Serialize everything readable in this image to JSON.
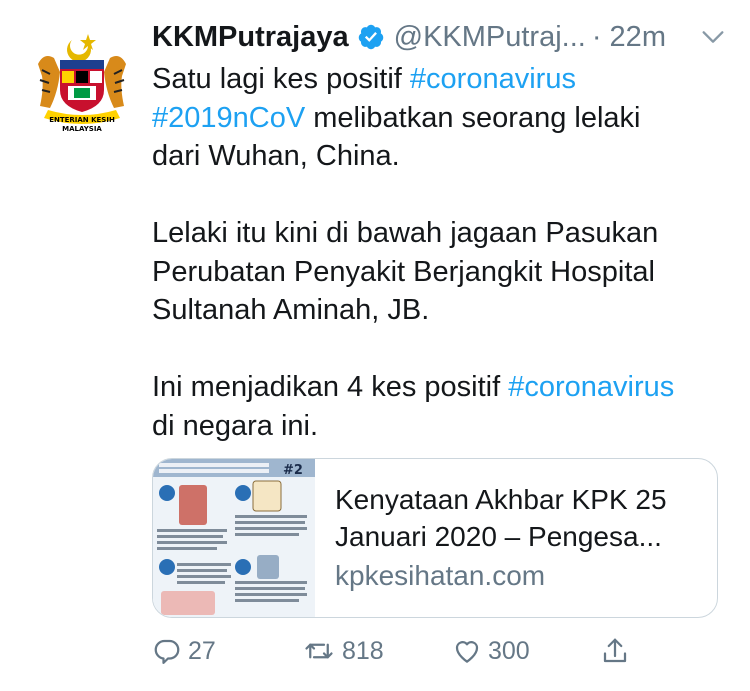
{
  "tweet": {
    "display_name": "KKMPutrajaya",
    "handle": "@KKMPutraj...",
    "time": "· 22m",
    "lines": [
      [
        {
          "t": "Satu lagi kes positif "
        },
        {
          "t": "#coronavirus",
          "tag": true
        }
      ],
      [
        {
          "t": "#2019nCoV",
          "tag": true
        },
        {
          "t": " melibatkan seorang lelaki"
        }
      ],
      [
        {
          "t": "dari Wuhan, China."
        }
      ],
      [],
      [
        {
          "t": "Lelaki itu kini di bawah jagaan Pasukan"
        }
      ],
      [
        {
          "t": "Perubatan Penyakit Berjangkit Hospital"
        }
      ],
      [
        {
          "t": "Sultanah Aminah, JB."
        }
      ],
      [],
      [
        {
          "t": "Ini menjadikan 4 kes positif "
        },
        {
          "t": "#coronavirus",
          "tag": true
        }
      ],
      [
        {
          "t": "di negara ini."
        }
      ]
    ]
  },
  "avatar": {
    "logo_text": "KEMENTERIAN KESIHATAN MALAYSIA",
    "logo_line1": "ENTERIAN KESIH",
    "logo_line2": "MALAYSIA"
  },
  "card": {
    "title_line1": "Kenyataan Akhbar KPK 25",
    "title_line2": "Januari 2020 – Pengesa...",
    "domain": "kpkesihatan.com",
    "thumb_badge": "#2"
  },
  "actions": {
    "reply_count": "27",
    "retweet_count": "818",
    "like_count": "300"
  },
  "colors": {
    "link": "#1da1f2",
    "muted": "#657786",
    "text": "#14171a",
    "border": "#ccd6dd"
  }
}
